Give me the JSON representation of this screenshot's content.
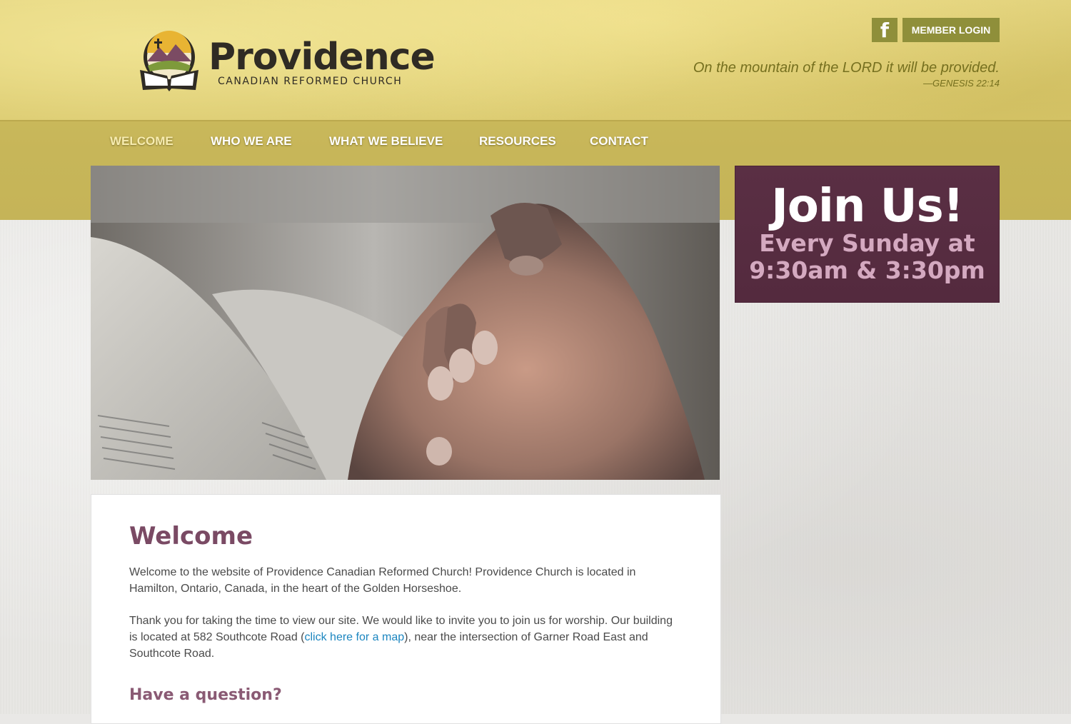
{
  "header": {
    "logo_name": "Providence",
    "logo_subtitle": "CANADIAN REFORMED CHURCH",
    "facebook_label": "f",
    "login_label": "MEMBER LOGIN",
    "tagline": "On the mountain of the LORD it will be provided.",
    "verse_reference": "—GENESIS 22:14"
  },
  "nav": {
    "items": [
      {
        "label": "WELCOME",
        "active": true
      },
      {
        "label": "WHO WE ARE",
        "active": false
      },
      {
        "label": "WHAT WE BELIEVE",
        "active": false
      },
      {
        "label": "RESOURCES",
        "active": false
      },
      {
        "label": "CONTACT",
        "active": false
      }
    ]
  },
  "hero": {
    "image_icon": "praying-hands-bible-photo"
  },
  "join": {
    "title": "Join Us!",
    "line1": "Every Sunday at",
    "line2": "9:30am & 3:30pm"
  },
  "content": {
    "heading": "Welcome",
    "paragraph1": "Welcome to the website of Providence Canadian Reformed Church! Providence Church is located in Hamilton, Ontario, Canada, in the heart of the Golden Horseshoe.",
    "paragraph2_before": "Thank you for taking the time to view our site. We would like to invite you to join us for worship. Our building is located at 582 Southcote Road (",
    "map_link": "click here for a map",
    "paragraph2_after": "), near the intersection of Garner Road East and Southcote Road.",
    "subheading": "Have a question?"
  },
  "colors": {
    "gold": "#d9c86d",
    "gold_dark": "#c7b659",
    "olive_button": "#8f8f3a",
    "plum": "#5a2f44",
    "heading_plum": "#7a4a64",
    "link_blue": "#1c86c0"
  }
}
